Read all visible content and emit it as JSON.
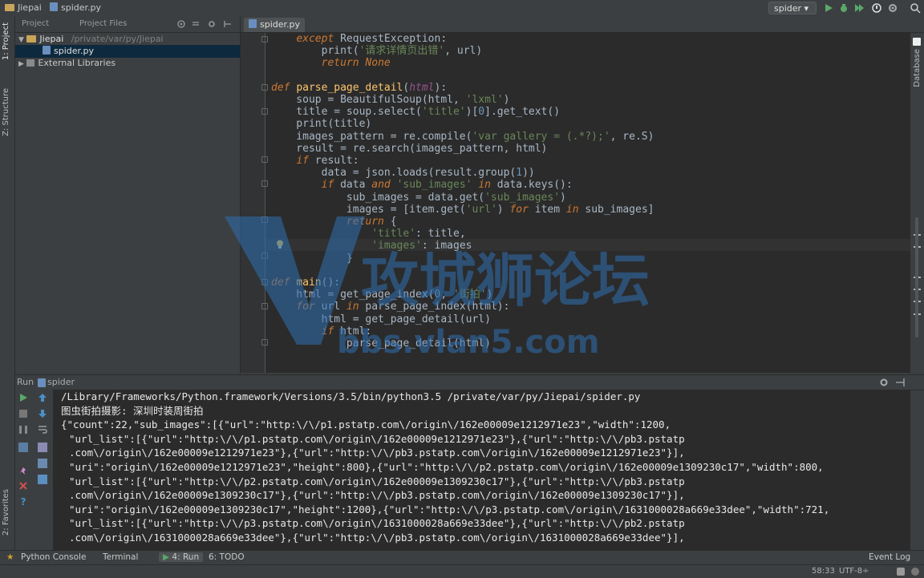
{
  "titlebar": {
    "project_crumb": "Jiepai",
    "file_crumb": "spider.py",
    "run_config": "spider ▾"
  },
  "left_stripe": {
    "project_label": "1: Project",
    "structure_label": "Z: Structure",
    "favorites_label": "2: Favorites"
  },
  "right_stripe": {
    "database_label": "Database"
  },
  "project_panel": {
    "tab_project": "Project",
    "tab_project_files": "Project Files",
    "root_name": "Jiepai",
    "root_path": "/private/var/py/Jiepai",
    "file_name": "spider.py",
    "external_libs": "External Libraries"
  },
  "editor": {
    "tab_label": "spider.py",
    "close_glyph": "×"
  },
  "code_lines": [
    "    except RequestException:",
    "        print('请求详情页出错', url)",
    "        return None",
    "",
    "def parse_page_detail(html):",
    "    soup = BeautifulSoup(html, 'lxml')",
    "    title = soup.select('title')[0].get_text()",
    "    print(title)",
    "    images_pattern = re.compile('var gallery = (.*?);', re.S)",
    "    result = re.search(images_pattern, html)",
    "    if result:",
    "        data = json.loads(result.group(1))",
    "        if data and 'sub_images' in data.keys():",
    "            sub_images = data.get('sub_images')",
    "            images = [item.get('url') for item in sub_images]",
    "            return {",
    "                'title': title,",
    "                'images': images",
    "            }",
    "",
    "def main():",
    "    html = get_page_index(0, '街拍')",
    "    for url in parse_page_index(html):",
    "        html = get_page_detail(url)",
    "        if html:",
    "            parse_page_detail(html)"
  ],
  "watermark": {
    "cn_text": "攻城狮论坛",
    "url_text": "bbs.vlan5.com"
  },
  "run_panel": {
    "title": "Run",
    "config": "spider"
  },
  "console_lines": [
    "/Library/Frameworks/Python.framework/Versions/3.5/bin/python3.5 /private/var/py/Jiepai/spider.py",
    "图虫街拍摄影: 深圳时装周街拍",
    "{\"count\":22,\"sub_images\":[{\"url\":\"http:\\/\\/p1.pstatp.com\\/origin\\/162e00009e1212971e23\",\"width\":1200,",
    "\"url_list\":[{\"url\":\"http:\\/\\/p1.pstatp.com\\/origin\\/162e00009e1212971e23\"},{\"url\":\"http:\\/\\/pb3.pstatp",
    ".com\\/origin\\/162e00009e1212971e23\"},{\"url\":\"http:\\/\\/pb3.pstatp.com\\/origin\\/162e00009e1212971e23\"}],",
    "\"uri\":\"origin\\/162e00009e1212971e23\",\"height\":800},{\"url\":\"http:\\/\\/p2.pstatp.com\\/origin\\/162e00009e1309230c17\",\"width\":800,",
    "\"url_list\":[{\"url\":\"http:\\/\\/p2.pstatp.com\\/origin\\/162e00009e1309230c17\"},{\"url\":\"http:\\/\\/pb3.pstatp",
    ".com\\/origin\\/162e00009e1309230c17\"},{\"url\":\"http:\\/\\/pb3.pstatp.com\\/origin\\/162e00009e1309230c17\"}],",
    "\"uri\":\"origin\\/162e00009e1309230c17\",\"height\":1200},{\"url\":\"http:\\/\\/p3.pstatp.com\\/origin\\/1631000028a669e33dee\",\"width\":721,",
    "\"url_list\":[{\"url\":\"http:\\/\\/p3.pstatp.com\\/origin\\/1631000028a669e33dee\"},{\"url\":\"http:\\/\\/pb2.pstatp",
    ".com\\/origin\\/1631000028a669e33dee\"},{\"url\":\"http:\\/\\/pb3.pstatp.com\\/origin\\/1631000028a669e33dee\"}],"
  ],
  "bottom_bar": {
    "python_console": "Python Console",
    "terminal": "Terminal",
    "run": "4: Run",
    "todo": "6: TODO",
    "event_log": "Event Log"
  },
  "status_bar": {
    "position": "58:33",
    "encoding": "UTF-8÷"
  },
  "colors": {
    "editor_bg": "#2b2b2b",
    "keyword": "#cc7832",
    "string": "#6a8759",
    "function": "#ffc66d",
    "number": "#6897bb",
    "param": "#94558d",
    "run_green": "#59a869"
  }
}
